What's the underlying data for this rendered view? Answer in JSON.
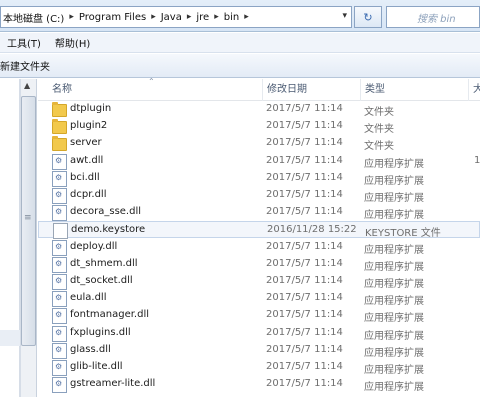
{
  "address": {
    "crumbs": [
      "本地磁盘 (C:)",
      "Program Files",
      "Java",
      "jre",
      "bin"
    ],
    "search_placeholder": "搜索 bin"
  },
  "menu": [
    "工具(T)",
    "帮助(H)"
  ],
  "toolbar": {
    "new_folder": "新建文件夹"
  },
  "columns": {
    "name": "名称",
    "date": "修改日期",
    "type": "类型",
    "size": "大小"
  },
  "files": [
    {
      "name": "dtplugin",
      "date": "2017/5/7 11:14",
      "type": "文件夹",
      "size": "",
      "icon": "folder-icon"
    },
    {
      "name": "plugin2",
      "date": "2017/5/7 11:14",
      "type": "文件夹",
      "size": "",
      "icon": "folder-icon"
    },
    {
      "name": "server",
      "date": "2017/5/7 11:14",
      "type": "文件夹",
      "size": "",
      "icon": "folder-icon"
    },
    {
      "name": "awt.dll",
      "date": "2017/5/7 11:14",
      "type": "应用程序扩展",
      "size": "1",
      "icon": "dll-icon"
    },
    {
      "name": "bci.dll",
      "date": "2017/5/7 11:14",
      "type": "应用程序扩展",
      "size": "",
      "icon": "dll-icon"
    },
    {
      "name": "dcpr.dll",
      "date": "2017/5/7 11:14",
      "type": "应用程序扩展",
      "size": "",
      "icon": "dll-icon"
    },
    {
      "name": "decora_sse.dll",
      "date": "2017/5/7 11:14",
      "type": "应用程序扩展",
      "size": "",
      "icon": "dll-icon"
    },
    {
      "name": "demo.keystore",
      "date": "2016/11/28 15:22",
      "type": "KEYSTORE 文件",
      "size": "",
      "icon": "file-icon"
    },
    {
      "name": "deploy.dll",
      "date": "2017/5/7 11:14",
      "type": "应用程序扩展",
      "size": "",
      "icon": "dll-icon"
    },
    {
      "name": "dt_shmem.dll",
      "date": "2017/5/7 11:14",
      "type": "应用程序扩展",
      "size": "",
      "icon": "dll-icon"
    },
    {
      "name": "dt_socket.dll",
      "date": "2017/5/7 11:14",
      "type": "应用程序扩展",
      "size": "",
      "icon": "dll-icon"
    },
    {
      "name": "eula.dll",
      "date": "2017/5/7 11:14",
      "type": "应用程序扩展",
      "size": "",
      "icon": "dll-icon"
    },
    {
      "name": "fontmanager.dll",
      "date": "2017/5/7 11:14",
      "type": "应用程序扩展",
      "size": "",
      "icon": "dll-icon"
    },
    {
      "name": "fxplugins.dll",
      "date": "2017/5/7 11:14",
      "type": "应用程序扩展",
      "size": "",
      "icon": "dll-icon"
    },
    {
      "name": "glass.dll",
      "date": "2017/5/7 11:14",
      "type": "应用程序扩展",
      "size": "",
      "icon": "dll-icon"
    },
    {
      "name": "glib-lite.dll",
      "date": "2017/5/7 11:14",
      "type": "应用程序扩展",
      "size": "",
      "icon": "dll-icon"
    },
    {
      "name": "gstreamer-lite.dll",
      "date": "2017/5/7 11:14",
      "type": "应用程序扩展",
      "size": "",
      "icon": "dll-icon"
    }
  ],
  "selected_index": 7
}
